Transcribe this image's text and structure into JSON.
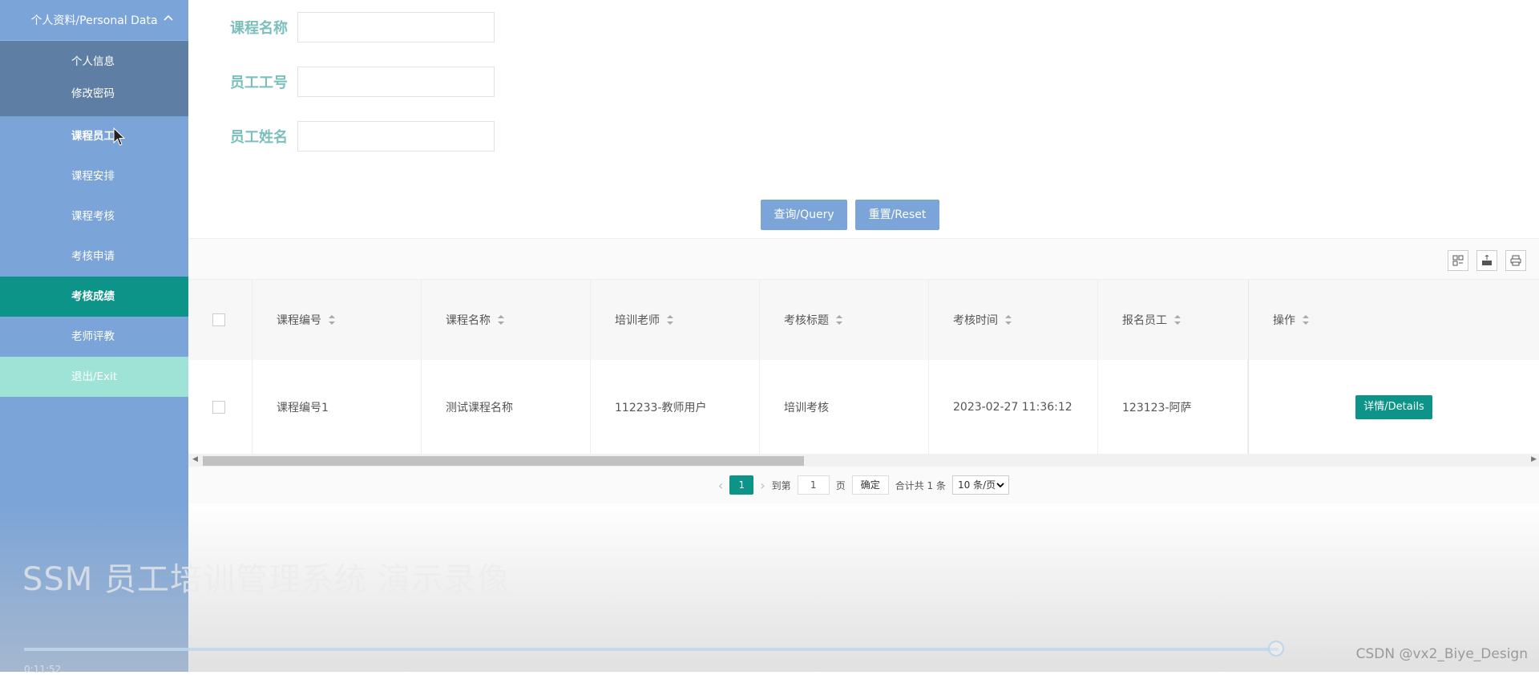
{
  "sidebar": {
    "group_title": "个人资料/Personal Data",
    "sub_items": [
      "个人信息",
      "修改密码"
    ],
    "items": [
      "课程员工",
      "课程安排",
      "课程考核",
      "考核申请",
      "考核成绩",
      "老师评教",
      "退出/Exit"
    ],
    "active_item": "考核成绩"
  },
  "search": {
    "fields": [
      {
        "label": "课程名称",
        "value": ""
      },
      {
        "label": "员工工号",
        "value": ""
      },
      {
        "label": "员工姓名",
        "value": ""
      }
    ],
    "query_label": "查询/Query",
    "reset_label": "重置/Reset"
  },
  "table": {
    "columns": [
      "课程编号",
      "课程名称",
      "培训老师",
      "考核标题",
      "考核时间",
      "报名员工",
      "操作"
    ],
    "rows": [
      {
        "course_no": "课程编号1",
        "course_name": "测试课程名称",
        "teacher": "112233-教师用户",
        "title": "培训考核",
        "time": "2023-02-27 11:36:12",
        "employee": "123123-阿萨",
        "action": "详情/Details"
      }
    ],
    "toolbar_icons": [
      "columns-icon",
      "export-icon",
      "print-icon"
    ]
  },
  "pagination": {
    "current_page": "1",
    "goto_label": "到第",
    "goto_value": "1",
    "page_unit": "页",
    "confirm_label": "确定",
    "total_label": "合计共 1 条",
    "page_size": "10 条/页"
  },
  "overlay": {
    "video_title": "SSM 员工培训管理系统 演示录像",
    "elapsed_time": "0:11:52",
    "progress": 0.83,
    "credit": "CSDN @vx2_Biye_Design"
  },
  "colors": {
    "sidebar_bg": "#7ba4d8",
    "submenu_bg": "#5e7fa3",
    "active_bg": "#0d9488",
    "exit_bg": "#9ee3d6",
    "label_color": "#7bbfbd"
  }
}
